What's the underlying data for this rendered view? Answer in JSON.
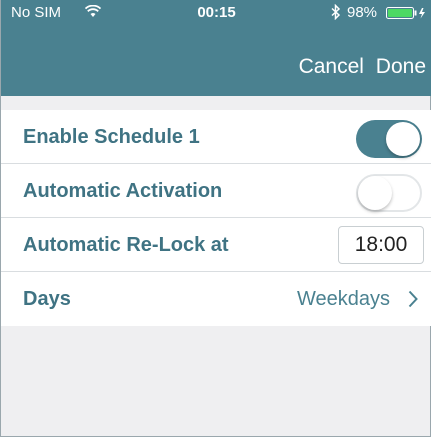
{
  "status": {
    "carrier": "No SIM",
    "time": "00:15",
    "battery": "98%",
    "icons": [
      "wifi-icon",
      "bluetooth-icon",
      "battery-icon"
    ]
  },
  "nav": {
    "cancel_label": "Cancel",
    "done_label": "Done"
  },
  "rows": [
    {
      "label": "Enable Schedule 1",
      "control": "toggle",
      "state": "on"
    },
    {
      "label": "Automatic Activation",
      "control": "toggle",
      "state": "off"
    },
    {
      "label": "Automatic Re-Lock at",
      "control": "time",
      "value": "18:00"
    },
    {
      "label": "Days",
      "control": "disclosure",
      "value": "Weekdays",
      "icon": "chevron-right-icon"
    }
  ],
  "colors": {
    "accent": "#4a8190",
    "label": "#3f7383",
    "background": "#efeff1"
  }
}
